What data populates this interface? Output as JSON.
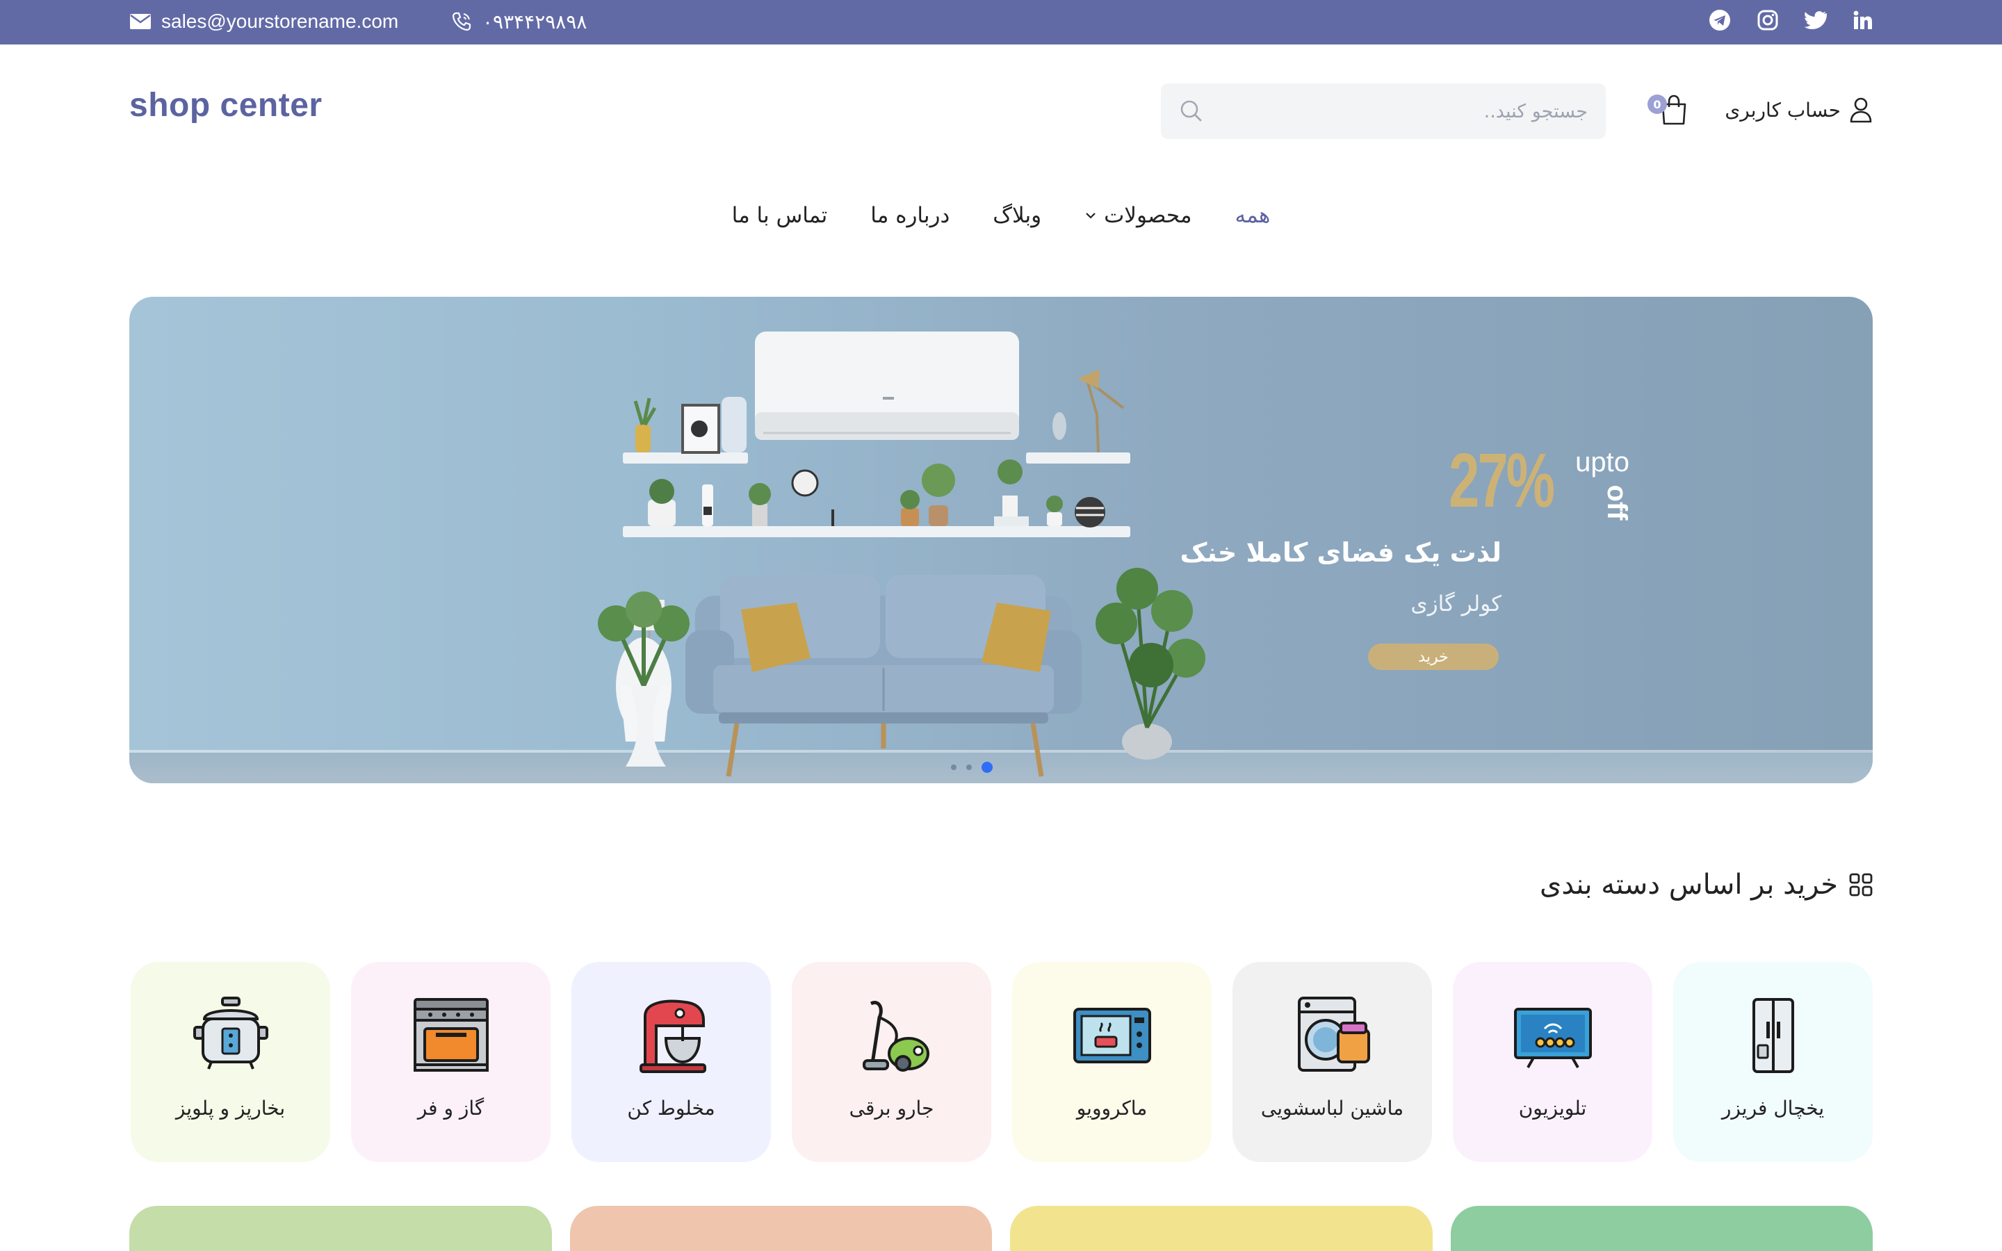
{
  "topbar": {
    "email": "sales@yourstorename.com",
    "phone": "۰۹۳۴۴۲۹۸۹۸",
    "social": [
      "telegram-icon",
      "instagram-icon",
      "twitter-icon",
      "linkedin-icon"
    ],
    "bg_color": "#626aa6"
  },
  "header": {
    "logo": "shop center",
    "search_placeholder": "جستجو کنید..",
    "cart_count": "0",
    "account_label": "حساب کاربری"
  },
  "nav": {
    "items": [
      {
        "label": "همه",
        "active": true
      },
      {
        "label": "محصولات",
        "has_dropdown": true
      },
      {
        "label": "وبلاگ"
      },
      {
        "label": "درباره ما"
      },
      {
        "label": "تماس با ما"
      }
    ],
    "accent_color": "#5b63a0"
  },
  "hero": {
    "promo_percent": "27%",
    "promo_upto": "upto",
    "promo_off": "off",
    "headline": "لذت یک فضای کاملا خنک",
    "subtitle": "کولر گازی",
    "button": "خرید",
    "slides": 3,
    "active_slide": 3
  },
  "categories": {
    "title": "خرید بر اساس دسته بندی",
    "items": [
      {
        "label": "یخچال فریزر",
        "icon": "fridge-icon",
        "bg": "#f1fcfc"
      },
      {
        "label": "تلویزیون",
        "icon": "tv-icon",
        "bg": "#fbf1fd"
      },
      {
        "label": "ماشین لباسشویی",
        "icon": "washing-machine-icon",
        "bg": "#f1f1f2"
      },
      {
        "label": "ماکروویو",
        "icon": "microwave-icon",
        "bg": "#fdfcea"
      },
      {
        "label": "جارو برقی",
        "icon": "vacuum-cleaner-icon",
        "bg": "#fcf0f0"
      },
      {
        "label": "مخلوط کن",
        "icon": "mixer-icon",
        "bg": "#eff2fe"
      },
      {
        "label": "گاز و فر",
        "icon": "stove-icon",
        "bg": "#fdf1f9"
      },
      {
        "label": "بخارپز و پلوپز",
        "icon": "rice-cooker-icon",
        "bg": "#f5fbe8"
      }
    ]
  },
  "banners": {
    "colors": [
      "#c4dda9",
      "#f0c5ae",
      "#f2e38e",
      "#8dcd9f"
    ]
  }
}
